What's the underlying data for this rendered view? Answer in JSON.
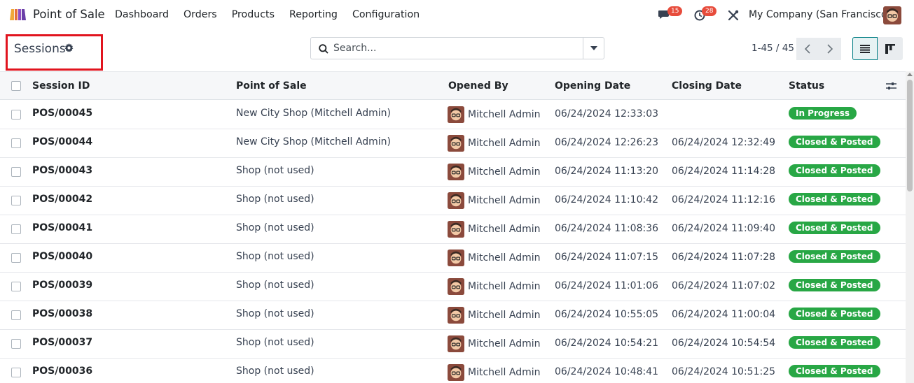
{
  "app": {
    "name": "Point of Sale"
  },
  "menu": [
    "Dashboard",
    "Orders",
    "Products",
    "Reporting",
    "Configuration"
  ],
  "systray": {
    "messages_count": "15",
    "activities_count": "28",
    "company": "My Company (San Francisco)"
  },
  "page": {
    "title": "Sessions"
  },
  "search": {
    "placeholder": "Search..."
  },
  "pager": {
    "text": "1-45 / 45"
  },
  "table": {
    "headers": {
      "session_id": "Session ID",
      "point_of_sale": "Point of Sale",
      "opened_by": "Opened By",
      "opening_date": "Opening Date",
      "closing_date": "Closing Date",
      "status": "Status"
    },
    "rows": [
      {
        "id": "POS/00045",
        "pos": "New City Shop (Mitchell Admin)",
        "user": "Mitchell Admin",
        "open": "06/24/2024 12:33:03",
        "close": "",
        "status": "In Progress"
      },
      {
        "id": "POS/00044",
        "pos": "New City Shop (Mitchell Admin)",
        "user": "Mitchell Admin",
        "open": "06/24/2024 12:26:23",
        "close": "06/24/2024 12:32:49",
        "status": "Closed & Posted"
      },
      {
        "id": "POS/00043",
        "pos": "Shop (not used)",
        "user": "Mitchell Admin",
        "open": "06/24/2024 11:13:20",
        "close": "06/24/2024 11:14:28",
        "status": "Closed & Posted"
      },
      {
        "id": "POS/00042",
        "pos": "Shop (not used)",
        "user": "Mitchell Admin",
        "open": "06/24/2024 11:10:42",
        "close": "06/24/2024 11:12:16",
        "status": "Closed & Posted"
      },
      {
        "id": "POS/00041",
        "pos": "Shop (not used)",
        "user": "Mitchell Admin",
        "open": "06/24/2024 11:08:36",
        "close": "06/24/2024 11:09:40",
        "status": "Closed & Posted"
      },
      {
        "id": "POS/00040",
        "pos": "Shop (not used)",
        "user": "Mitchell Admin",
        "open": "06/24/2024 11:07:15",
        "close": "06/24/2024 11:07:28",
        "status": "Closed & Posted"
      },
      {
        "id": "POS/00039",
        "pos": "Shop (not used)",
        "user": "Mitchell Admin",
        "open": "06/24/2024 11:01:06",
        "close": "06/24/2024 11:07:02",
        "status": "Closed & Posted"
      },
      {
        "id": "POS/00038",
        "pos": "Shop (not used)",
        "user": "Mitchell Admin",
        "open": "06/24/2024 10:55:05",
        "close": "06/24/2024 11:00:04",
        "status": "Closed & Posted"
      },
      {
        "id": "POS/00037",
        "pos": "Shop (not used)",
        "user": "Mitchell Admin",
        "open": "06/24/2024 10:54:21",
        "close": "06/24/2024 10:54:54",
        "status": "Closed & Posted"
      },
      {
        "id": "POS/00036",
        "pos": "Shop (not used)",
        "user": "Mitchell Admin",
        "open": "06/24/2024 10:48:41",
        "close": "06/24/2024 10:51:25",
        "status": "Closed & Posted"
      }
    ]
  },
  "colors": {
    "status_green": "#28a745",
    "badge_red": "#e74c3c",
    "highlight_red": "#e1141e",
    "active_view": "#017e84"
  }
}
